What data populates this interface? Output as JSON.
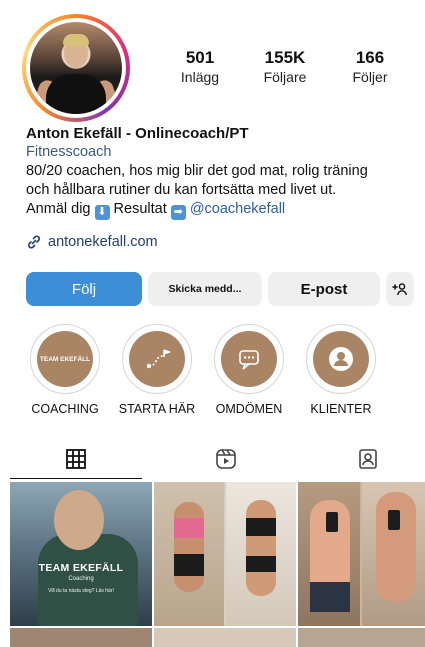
{
  "profile": {
    "name": "Anton Ekefäll - Onlinecoach/PT",
    "category": "Fitnesscoach",
    "bio_line1": "80/20 coachen, hos mig blir det god mat, rolig träning",
    "bio_line2": "och hållbara rutiner du kan fortsätta med livet ut.",
    "bio_line3_pre": "Anmäl dig",
    "bio_arrow_down": "⬇",
    "bio_line3_mid": "Resultat",
    "bio_arrow_right": "➡",
    "bio_mention": "@coachekefall",
    "link": "antonekefall.com"
  },
  "stats": [
    {
      "value": "501",
      "label": "Inlägg"
    },
    {
      "value": "155K",
      "label": "Följare"
    },
    {
      "value": "166",
      "label": "Följer"
    }
  ],
  "buttons": {
    "follow": "Följ",
    "message": "Skicka medd...",
    "email": "E-post",
    "suggest": "+♀"
  },
  "highlights": [
    {
      "label": "COACHING",
      "cover_text": "TEAM EKEFÄLL",
      "icon": "team-logo"
    },
    {
      "label": "STARTA HÄR",
      "cover_text": "",
      "icon": "path-icon"
    },
    {
      "label": "OMDÖMEN",
      "cover_text": "",
      "icon": "chat-bubble-icon"
    },
    {
      "label": "KLIENTER",
      "cover_text": "",
      "icon": "person-icon"
    }
  ],
  "tabs": [
    {
      "name": "grid",
      "icon": "grid-icon",
      "active": true
    },
    {
      "name": "reels",
      "icon": "reels-icon",
      "active": false
    },
    {
      "name": "tagged",
      "icon": "tagged-icon",
      "active": false
    }
  ],
  "posts": [
    {
      "title": "TEAM EKEFÄLL",
      "subtitle": "Coaching",
      "caption": "Vill du ta nästa steg?  Läs här!"
    }
  ],
  "colors": {
    "follow_button": "#3c8fd6",
    "link": "#1d3f73",
    "category": "#3a5a86",
    "highlight_disc": "#a98465"
  }
}
